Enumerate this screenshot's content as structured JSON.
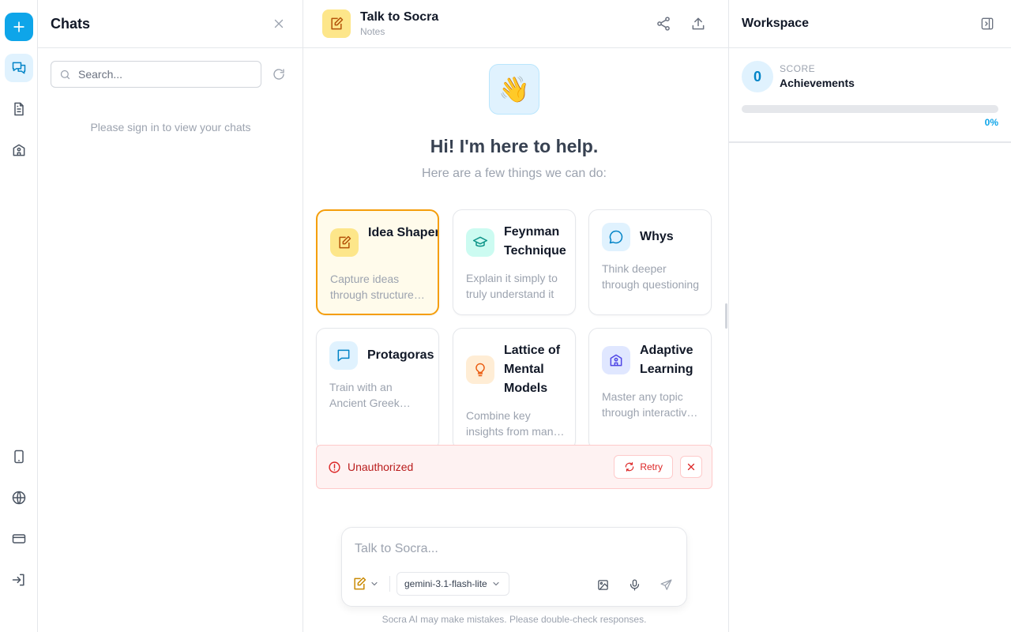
{
  "rail": {
    "items": [
      {
        "name": "plus-icon"
      },
      {
        "name": "chats-icon"
      },
      {
        "name": "notes-icon"
      },
      {
        "name": "school-icon"
      },
      {
        "name": "tablet-icon"
      },
      {
        "name": "globe-icon"
      },
      {
        "name": "credit-card-icon"
      },
      {
        "name": "sign-in-icon"
      }
    ]
  },
  "chats": {
    "title": "Chats",
    "search_placeholder": "Search...",
    "empty_message": "Please sign in to view your chats"
  },
  "header": {
    "title": "Talk to Socra",
    "subtitle": "Notes"
  },
  "hero": {
    "emoji": "👋",
    "title": "Hi! I'm here to help.",
    "subtitle": "Here are a few things we can do:"
  },
  "cards": [
    {
      "title": "Idea Shaper",
      "description": "Capture ideas through structured notes",
      "icon": "note-edit-icon",
      "color": "#fde68a",
      "icon_color": "#b45309",
      "selected": true
    },
    {
      "title": "Feynman Technique",
      "description": "Explain it simply to truly understand it",
      "icon": "graduation-cap-icon",
      "color": "#ccfbf1",
      "icon_color": "#0d9488",
      "selected": false
    },
    {
      "title": "Whys",
      "description": "Think deeper through questioning",
      "icon": "chat-bubble-icon",
      "color": "#e0f2fe",
      "icon_color": "#0284c7",
      "selected": false
    },
    {
      "title": "Protagoras",
      "description": "Train with an Ancient Greek sophist",
      "icon": "message-square-icon",
      "color": "#e0f2fe",
      "icon_color": "#0284c7",
      "selected": false
    },
    {
      "title": "Lattice of Mental Models",
      "description": "Combine key insights from many disciplines",
      "icon": "lightbulb-icon",
      "color": "#ffedd5",
      "icon_color": "#ea580c",
      "selected": false
    },
    {
      "title": "Adaptive Learning",
      "description": "Master any topic through interactive lessons",
      "icon": "school-icon",
      "color": "#e0e7ff",
      "icon_color": "#4f46e5",
      "selected": false
    }
  ],
  "error": {
    "message": "Unauthorized",
    "retry_label": "Retry"
  },
  "composer": {
    "placeholder": "Talk to Socra...",
    "model": "gemini-3.1-flash-lite",
    "disclaimer": "Socra AI may make mistakes. Please double-check responses."
  },
  "workspace": {
    "title": "Workspace",
    "score_value": "0",
    "score_label": "SCORE",
    "score_name": "Achievements",
    "progress_pct": "0%",
    "progress": 0
  },
  "colors": {
    "accent": "#0ea5e9",
    "selected_border": "#f59e0b",
    "error": "#dc2626"
  }
}
